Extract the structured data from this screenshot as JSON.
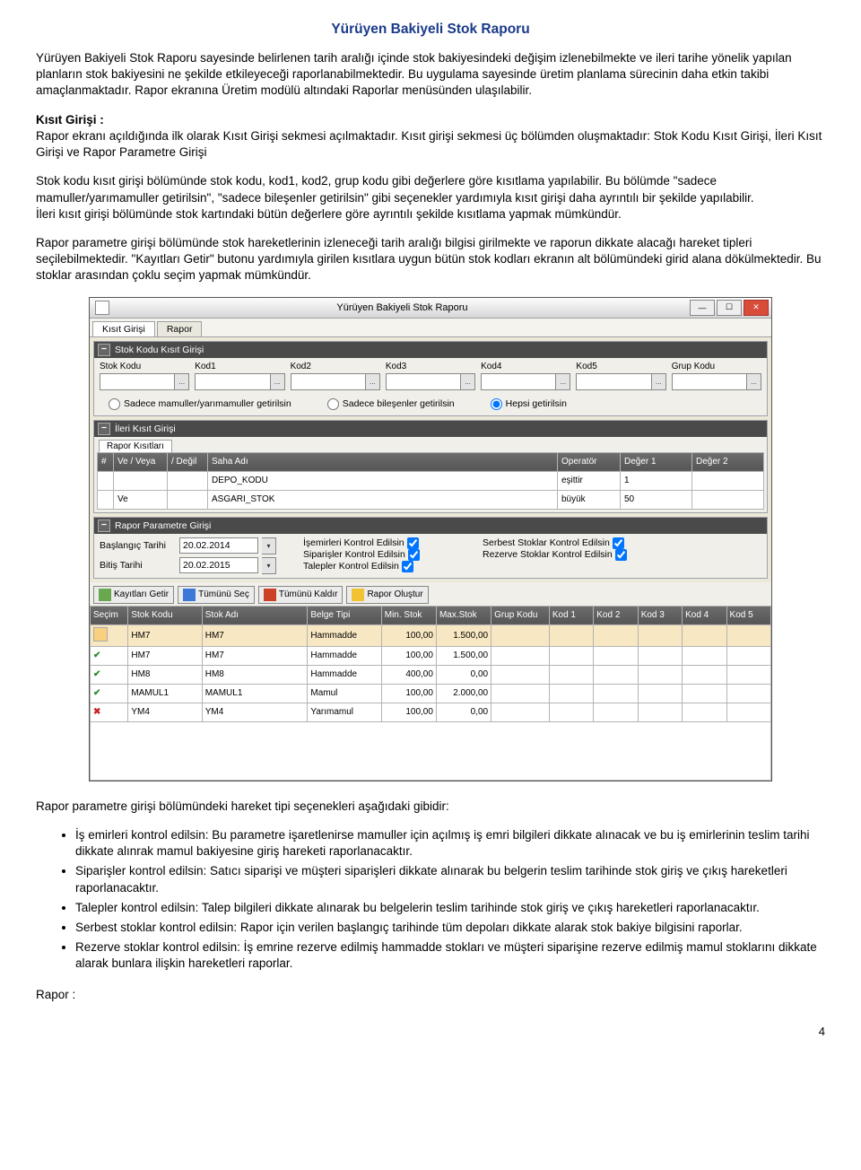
{
  "doc": {
    "title": "Yürüyen Bakiyeli Stok Raporu",
    "p1": "Yürüyen Bakiyeli Stok Raporu sayesinde belirlenen tarih aralığı içinde stok bakiyesindeki değişim izlenebilmekte ve ileri tarihe yönelik yapılan planların stok bakiyesini ne şekilde etkileyeceği raporlanabilmektedir. Bu uygulama sayesinde üretim planlama sürecinin daha etkin takibi amaçlanmaktadır. Rapor ekranına Üretim modülü altındaki Raporlar menüsünden ulaşılabilir.",
    "kisitHdr": "Kısıt Girişi :",
    "p2": "Rapor ekranı açıldığında ilk olarak Kısıt Girişi sekmesi açılmaktadır. Kısıt girişi sekmesi üç bölümden oluşmaktadır: Stok Kodu Kısıt Girişi, İleri Kısıt Girişi ve Rapor Parametre Girişi",
    "p3": "Stok kodu kısıt girişi bölümünde stok kodu, kod1, kod2, grup kodu gibi değerlere göre kısıtlama yapılabilir. Bu bölümde \"sadece mamuller/yarımamuller getirilsin\", \"sadece bileşenler getirilsin\" gibi seçenekler yardımıyla kısıt girişi daha ayrıntılı bir şekilde yapılabilir.",
    "p3b": "İleri kısıt girişi bölümünde stok kartındaki bütün değerlere göre ayrıntılı şekilde kısıtlama yapmak mümkündür.",
    "p4": "Rapor parametre girişi bölümünde stok hareketlerinin izleneceği tarih aralığı bilgisi girilmekte ve raporun dikkate alacağı hareket tipleri seçilebilmektedir.  \"Kayıtları Getir\" butonu yardımıyla girilen kısıtlara uygun bütün stok kodları ekranın alt bölümündeki girid alana dökülmektedir. Bu stoklar arasından çoklu seçim yapmak mümkündür.",
    "p5intro": "Rapor parametre girişi bölümündeki hareket tipi seçenekleri aşağıdaki gibidir:",
    "bullets": [
      "İş emirleri kontrol edilsin: Bu parametre işaretlenirse mamuller için açılmış iş emri bilgileri dikkate alınacak ve bu iş emirlerinin teslim tarihi dikkate alınrak mamul bakiyesine giriş hareketi raporlanacaktır.",
      "Siparişler kontrol edilsin: Satıcı siparişi ve müşteri siparişleri dikkate alınarak bu belgerin teslim tarihinde stok giriş ve çıkış hareketleri raporlanacaktır.",
      "Talepler kontrol edilsin: Talep bilgileri dikkate alınarak bu belgelerin teslim tarihinde stok giriş ve çıkış hareketleri raporlanacaktır.",
      "Serbest stoklar kontrol edilsin: Rapor için verilen başlangıç tarihinde tüm depoları dikkate alarak stok bakiye bilgisini raporlar.",
      "Rezerve stoklar kontrol edilsin: İş emrine rezerve edilmiş hammadde stokları ve müşteri siparişine rezerve edilmiş mamul stoklarını dikkate alarak bunlara ilişkin hareketleri raporlar."
    ],
    "footerLabel": "Rapor :",
    "pageNum": "4"
  },
  "win": {
    "title": "Yürüyen Bakiyeli Stok Raporu",
    "tabs": [
      "Kısıt Girişi",
      "Rapor"
    ],
    "group1": {
      "header": "Stok Kodu Kısıt Girişi",
      "fields": [
        "Stok Kodu",
        "Kod1",
        "Kod2",
        "Kod3",
        "Kod4",
        "Kod5",
        "Grup Kodu"
      ],
      "radios": [
        "Sadece mamuller/yarımamuller getirilsin",
        "Sadece bileşenler getirilsin",
        "Hepsi getirilsin"
      ]
    },
    "group2": {
      "header": "İleri Kısıt Girişi",
      "subtab": "Rapor Kısıtları",
      "cols": [
        "#",
        "Ve / Veya",
        "/ Değil",
        "Saha Adı",
        "Operatör",
        "Değer 1",
        "Değer 2"
      ],
      "rows": [
        {
          "veveya": "",
          "degil": "",
          "saha": "DEPO_KODU",
          "op": "eşittir",
          "d1": "1",
          "d2": ""
        },
        {
          "veveya": "Ve",
          "degil": "",
          "saha": "ASGARI_STOK",
          "op": "büyük",
          "d1": "50",
          "d2": ""
        }
      ]
    },
    "group3": {
      "header": "Rapor Parametre Girişi",
      "rows": [
        {
          "label": "Başlangıç Tarihi",
          "value": "20.02.2014"
        },
        {
          "label": "Bitiş Tarihi",
          "value": "20.02.2015"
        }
      ],
      "checks1": [
        "İşemirleri Kontrol Edilsin",
        "Siparişler Kontrol Edilsin",
        "Talepler Kontrol Edilsin"
      ],
      "checks2": [
        "Serbest Stoklar Kontrol Edilsin",
        "Rezerve Stoklar Kontrol Edilsin"
      ]
    },
    "toolbar": [
      "Kayıtları Getir",
      "Tümünü Seç",
      "Tümünü Kaldır",
      "Rapor Oluştur"
    ],
    "grid": {
      "cols": [
        "Seçim",
        "Stok Kodu",
        "Stok Adı",
        "Belge Tipi",
        "Min. Stok",
        "Max.Stok",
        "Grup Kodu",
        "Kod 1",
        "Kod 2",
        "Kod 3",
        "Kod 4",
        "Kod 5"
      ],
      "rows": [
        {
          "sel": "check",
          "kod": "HM7",
          "ad": "HM7",
          "tip": "Hammadde",
          "min": "100,00",
          "max": "1.500,00"
        },
        {
          "sel": "check",
          "kod": "HM8",
          "ad": "HM8",
          "tip": "Hammadde",
          "min": "400,00",
          "max": "0,00"
        },
        {
          "sel": "check",
          "kod": "MAMUL1",
          "ad": "MAMUL1",
          "tip": "Mamul",
          "min": "100,00",
          "max": "2.000,00"
        },
        {
          "sel": "x",
          "kod": "YM4",
          "ad": "YM4",
          "tip": "Yarımamul",
          "min": "100,00",
          "max": "0,00"
        }
      ]
    }
  }
}
